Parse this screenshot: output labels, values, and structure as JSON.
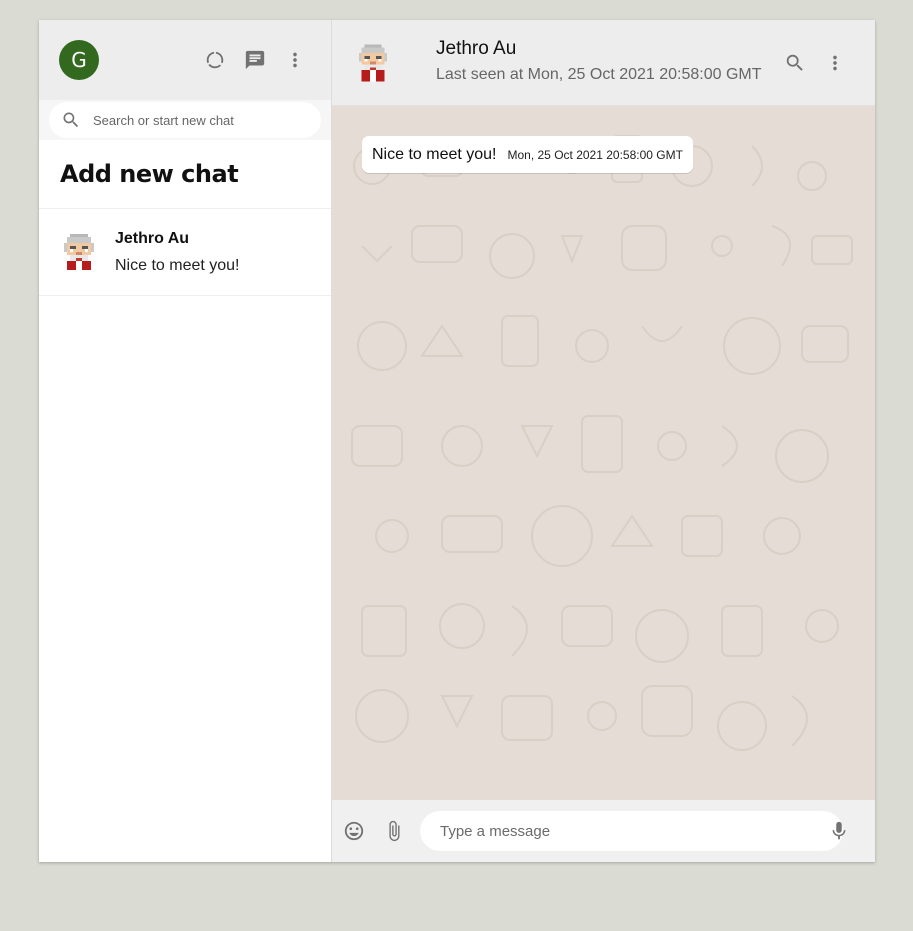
{
  "sidebar": {
    "user_initial": "G",
    "user_avatar_color": "#33691e",
    "icons": [
      "status-icon",
      "new-chat-icon",
      "menu-icon"
    ],
    "search_placeholder": "Search or start new chat",
    "add_new_chat": "Add new chat",
    "chats": [
      {
        "name": "Jethro Au",
        "last_message": "Nice to meet you!"
      }
    ]
  },
  "chat": {
    "contact_name": "Jethro Au",
    "status": "Last seen at Mon, 25 Oct 2021 20:58:00 GMT",
    "messages": [
      {
        "text": "Nice to meet you!",
        "time": "Mon, 25 Oct 2021 20:58:00 GMT"
      }
    ],
    "composer_placeholder": "Type a message"
  },
  "colors": {
    "background": "#dadbd3",
    "header": "#ededed",
    "chat_wallpaper": "#e5ddd5",
    "icon": "#727272"
  }
}
